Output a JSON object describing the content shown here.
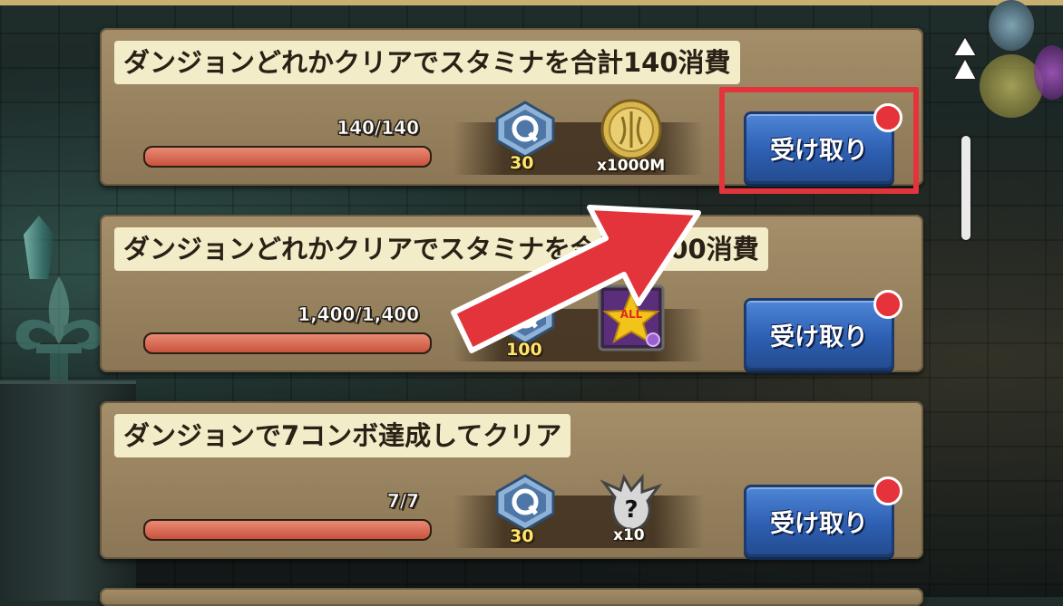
{
  "missions": [
    {
      "title": "ダンジョンどれかクリアでスタミナを合計140消費",
      "progress_text": "140/140",
      "progress": 1.0,
      "reward1_count": "30",
      "reward2_count": "x1000M",
      "reward2_icon": "coin-icon",
      "claim_label": "受け取り",
      "highlighted": true
    },
    {
      "title": "ダンジョンどれかクリアでスタミナを合計1,400消費",
      "progress_text": "1,400/1,400",
      "progress": 1.0,
      "reward1_count": "100",
      "reward2_icon": "all-star-card-icon",
      "reward2_icon_text": "ALL",
      "claim_label": "受け取り",
      "highlighted": false
    },
    {
      "title": "ダンジョンで7コンボ達成してクリア",
      "progress_text": "7/7",
      "progress": 1.0,
      "reward1_count": "30",
      "reward2_count": "x10",
      "reward2_icon": "mystery-dragon-icon",
      "claim_label": "受け取り",
      "highlighted": false
    }
  ],
  "colors": {
    "card": "#9a8560",
    "title_bg": "#f3ecc9",
    "progress_fill": "#d96a54",
    "claim_button": "#3a6fc4",
    "badge": "#e5323b",
    "highlight": "#e4343b"
  }
}
